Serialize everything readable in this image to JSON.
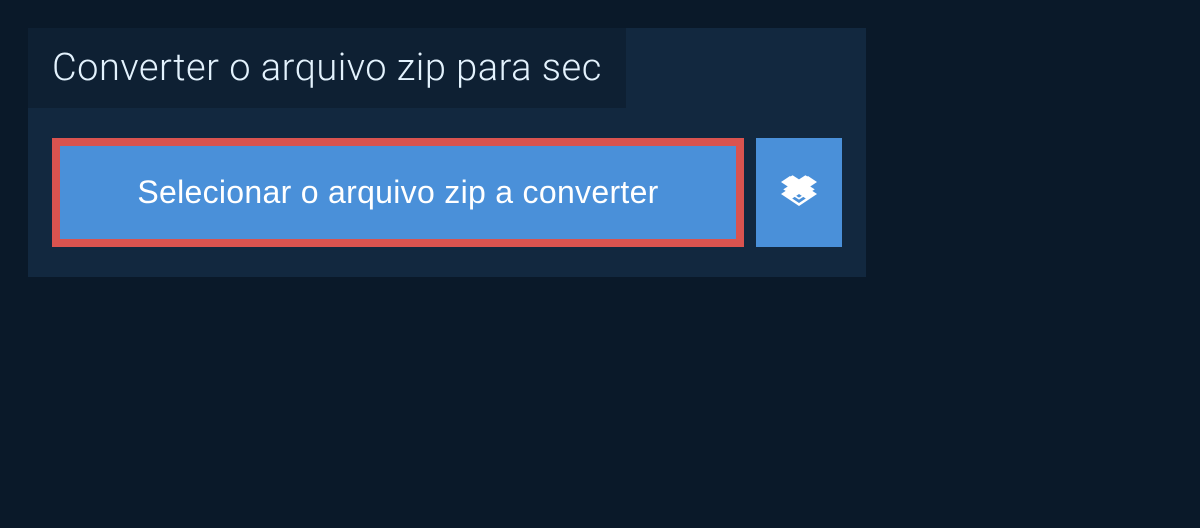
{
  "title": "Converter o arquivo zip para sec",
  "select_button_label": "Selecionar o arquivo zip a converter",
  "dropbox_button_name": "dropbox"
}
